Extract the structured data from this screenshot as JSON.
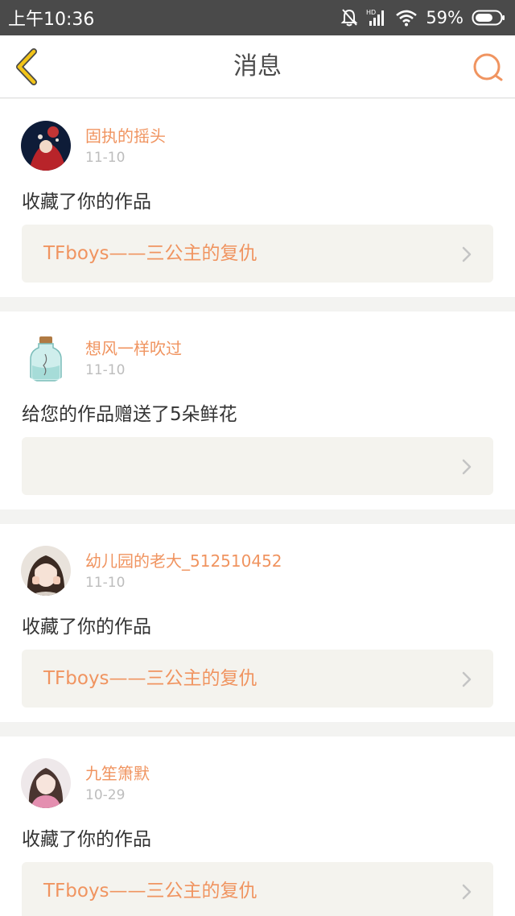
{
  "status_bar": {
    "time": "上午10:36",
    "battery": "59%",
    "icons": [
      "bell-muted-icon",
      "hd-signal-icon",
      "wifi-icon",
      "battery-icon"
    ]
  },
  "nav": {
    "title": "消息",
    "back_icon": "chevron-left-icon",
    "search_icon": "search-icon",
    "accent_color": "#f09460"
  },
  "messages": [
    {
      "username": "固执的摇头",
      "date": "11-10",
      "action": "收藏了你的作品",
      "work_title": "TFboys——三公主的复仇"
    },
    {
      "username": "想风一样吹过",
      "date": "11-10",
      "action": "给您的作品赠送了5朵鲜花",
      "work_title": ""
    },
    {
      "username": "幼儿园的老大_512510452",
      "date": "11-10",
      "action": "收藏了你的作品",
      "work_title": "TFboys——三公主的复仇"
    },
    {
      "username": "九笙箫默",
      "date": "10-29",
      "action": "收藏了你的作品",
      "work_title": "TFboys——三公主的复仇"
    }
  ]
}
